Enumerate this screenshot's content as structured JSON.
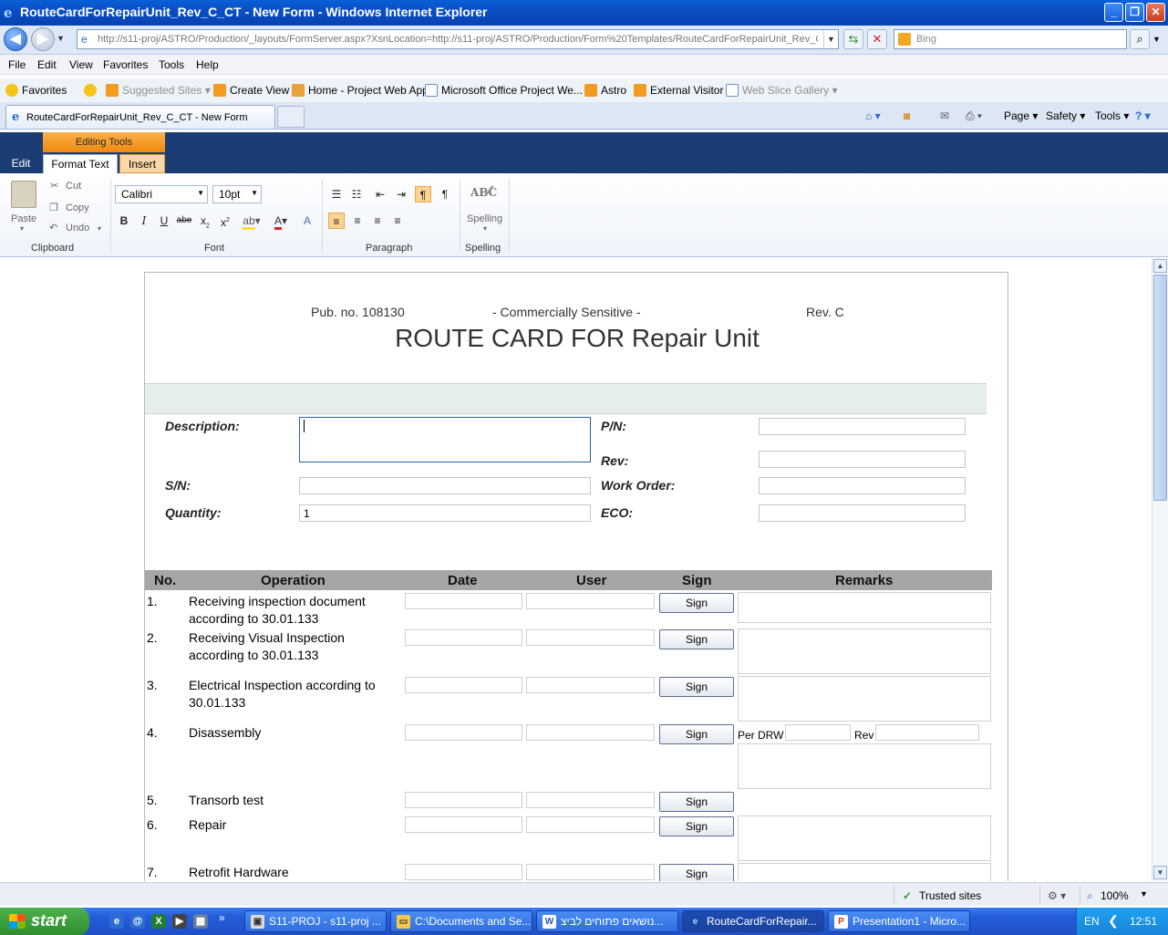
{
  "window": {
    "title": "RouteCardForRepairUnit_Rev_C_CT - New Form - Windows Internet Explorer",
    "minimize": "_",
    "restore": "❐",
    "close": "✕"
  },
  "address": {
    "url": "http://s11-proj/ASTRO/Production/_layouts/FormServer.aspx?XsnLocation=http://s11-proj/ASTRO/Production/Form%20Templates/RouteCardForRepairUnit_Rev_C",
    "search_placeholder": "Bing"
  },
  "menu": [
    "File",
    "Edit",
    "View",
    "Favorites",
    "Tools",
    "Help"
  ],
  "favorites": {
    "label": "Favorites",
    "items": [
      "Suggested Sites ▾",
      "Create View",
      "Home - Project Web App",
      "Microsoft Office Project We...",
      "Astro",
      "External Visitor",
      "Web Slice Gallery ▾"
    ]
  },
  "tab": {
    "label": "RouteCardForRepairUnit_Rev_C_CT - New Form"
  },
  "command_bar": [
    "Page ▾",
    "Safety ▾",
    "Tools ▾"
  ],
  "ribbon": {
    "context_label": "Editing Tools",
    "tabs": [
      "Edit",
      "Format Text",
      "Insert"
    ],
    "clipboard": {
      "paste": "Paste",
      "cut": "Cut",
      "copy": "Copy",
      "undo": "Undo",
      "group": "Clipboard"
    },
    "font": {
      "family": "Calibri",
      "size": "10pt",
      "group": "Font"
    },
    "paragraph": {
      "group": "Paragraph"
    },
    "spelling": {
      "label": "Spelling",
      "group": "Spelling",
      "abc": "ABC"
    }
  },
  "form": {
    "pub_no": "Pub. no. 108130",
    "sensitivity": "- Commercially Sensitive -",
    "rev": "Rev. C",
    "title": "ROUTE CARD FOR Repair Unit",
    "labels": {
      "description": "Description:",
      "pn": "P/N:",
      "rev": "Rev:",
      "sn": "S/N:",
      "work_order": "Work Order:",
      "quantity": "Quantity:",
      "eco": "ECO:"
    },
    "quantity_value": "1",
    "table": {
      "headers": [
        "No.",
        "Operation",
        "Date",
        "User",
        "Sign",
        "Remarks"
      ],
      "sign_label": "Sign",
      "rows": [
        {
          "no": "1.",
          "operation": "Receiving inspection document according to 30.01.133"
        },
        {
          "no": "2.",
          "operation": "Receiving Visual Inspection according to 30.01.133"
        },
        {
          "no": "3.",
          "operation": "Electrical Inspection according to 30.01.133"
        },
        {
          "no": "4.",
          "operation": "Disassembly"
        },
        {
          "no": "5.",
          "operation": "Transorb test"
        },
        {
          "no": "6.",
          "operation": "Repair"
        },
        {
          "no": "7.",
          "operation": "Retrofit Hardware"
        }
      ],
      "per_drw": "Per DRW",
      "rev_small": "Rev"
    }
  },
  "status": {
    "zone": "Trusted sites",
    "zoom": "100%"
  },
  "taskbar": {
    "start": "start",
    "tasks": [
      "S11-PROJ - s11-proj ...",
      "C:\\Documents and Se...",
      "נושאים פתוחים לביצ...",
      "RouteCardForRepair...",
      "Presentation1 - Micro..."
    ],
    "lang": "EN",
    "time": "12:51"
  }
}
